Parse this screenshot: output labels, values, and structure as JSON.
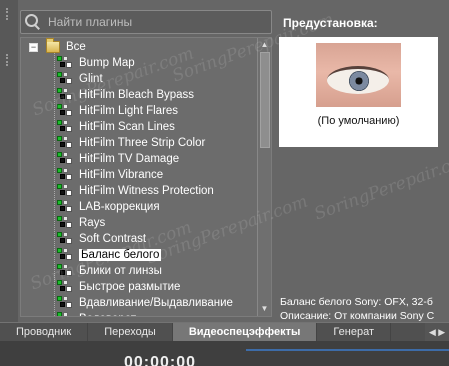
{
  "search": {
    "placeholder": "Найти плагины"
  },
  "tree": {
    "root_expander": "−",
    "root_label": "Все",
    "items": [
      "Bump Map",
      "Glint",
      "HitFilm Bleach Bypass",
      "HitFilm Light Flares",
      "HitFilm Scan Lines",
      "HitFilm Three Strip Color",
      "HitFilm TV Damage",
      "HitFilm Vibrance",
      "HitFilm Witness Protection",
      "LAB-коррекция",
      "Rays",
      "Soft Contrast",
      "Баланс белого",
      "Блики от линзы",
      "Быстрое размытие",
      "Вдавливание/Выдавливание",
      "Водоворот"
    ],
    "selected_index": 12
  },
  "preset": {
    "title": "Предустановка:",
    "caption": "(По умолчанию)"
  },
  "info": {
    "line1": "Баланс белого Sony: OFX, 32-б",
    "line2": "Описание: От компании Sony C"
  },
  "tabs": [
    {
      "label": "Проводник",
      "active": false
    },
    {
      "label": "Переходы",
      "active": false
    },
    {
      "label": "Видеоспецэффекты",
      "active": true
    },
    {
      "label": "Генерат",
      "active": false
    }
  ],
  "timeline": {
    "timecode": "00:00:00"
  },
  "watermark_text": "SoringPerepair.com",
  "colors": {
    "panel": "#666666",
    "selection_bg": "#ffffff",
    "plugin_green": "#1bbf2b",
    "timeline_accent": "#3d6ca8"
  }
}
